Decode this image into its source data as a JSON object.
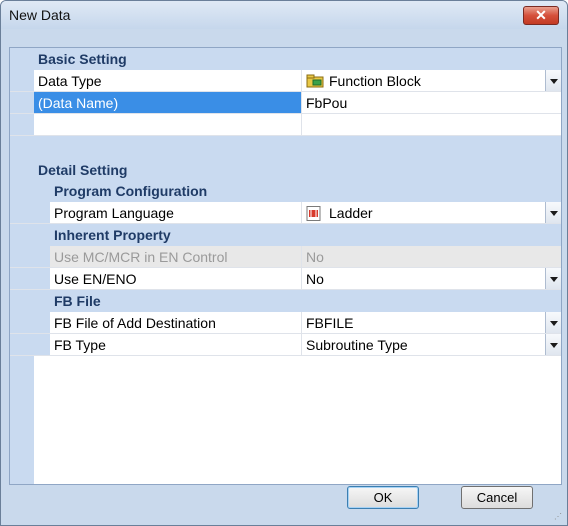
{
  "window": {
    "title": "New Data",
    "close_symbol": "✕"
  },
  "colors": {
    "section_bg": "#c9daf0",
    "selected_bg": "#3a8ee6",
    "title_gradient_top": "#dfe9f5"
  },
  "sections": {
    "basic": "Basic Setting",
    "detail": "Detail Setting",
    "program_config": "Program Configuration",
    "inherent": "Inherent Property",
    "fb_file": "FB File"
  },
  "rows": {
    "data_type": {
      "label": "Data Type",
      "value": "Function Block",
      "icon": "function-block-icon"
    },
    "data_name": {
      "label": "(Data Name)",
      "value": "FbPou"
    },
    "program_language": {
      "label": "Program Language",
      "value": "Ladder",
      "icon": "ladder-icon"
    },
    "use_mc_mcr": {
      "label": "Use MC/MCR in EN Control",
      "value": "No"
    },
    "use_en_eno": {
      "label": "Use EN/ENO",
      "value": "No"
    },
    "fb_file_dest": {
      "label": "FB File of Add Destination",
      "value": "FBFILE"
    },
    "fb_type": {
      "label": "FB Type",
      "value": "Subroutine Type"
    }
  },
  "buttons": {
    "ok": "OK",
    "cancel": "Cancel"
  }
}
